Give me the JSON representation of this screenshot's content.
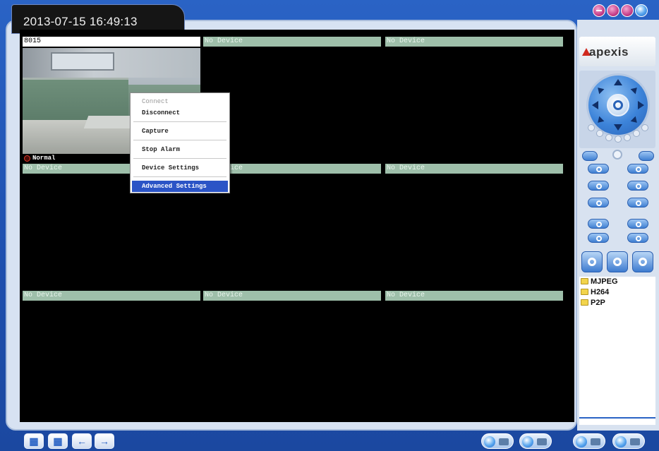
{
  "header": {
    "datetime": "2013-07-15   16:49:13"
  },
  "brand": {
    "logo_text": "apexis",
    "accent_color": "#d0281d"
  },
  "window_controls": [
    "minimize-icon",
    "skin-icon",
    "lock-icon",
    "power-icon"
  ],
  "video_grid": {
    "cells": [
      {
        "title": "8015",
        "state": "connected",
        "status_text": "Normal"
      },
      {
        "title": "No Device"
      },
      {
        "title": "No Device"
      },
      {
        "title": "No Device"
      },
      {
        "title": "No Device"
      },
      {
        "title": "No Device"
      },
      {
        "title": "No Device"
      },
      {
        "title": "No Device"
      },
      {
        "title": "No Device"
      }
    ]
  },
  "context_menu": {
    "items": [
      {
        "label": "Connect",
        "enabled": false
      },
      {
        "label": "Disconnect",
        "enabled": true
      },
      {
        "label": "Capture",
        "enabled": true
      },
      {
        "label": "Stop Alarm",
        "enabled": true
      },
      {
        "label": "Device Settings",
        "enabled": true
      },
      {
        "label": "Advanced Settings",
        "enabled": true,
        "highlighted": true
      }
    ]
  },
  "device_tree": {
    "nodes": [
      {
        "label": "MJPEG",
        "icon": "folder-icon"
      },
      {
        "label": "H264",
        "icon": "folder-icon"
      },
      {
        "label": "P2P",
        "icon": "folder-icon"
      }
    ]
  },
  "bottom_toolbar": {
    "left_buttons": [
      "layout-4-icon",
      "layout-9-icon",
      "prev-page-icon",
      "next-page-icon"
    ],
    "right_buttons": [
      "record-icon",
      "snapshot-icon",
      "playback-icon",
      "settings-icon"
    ]
  }
}
